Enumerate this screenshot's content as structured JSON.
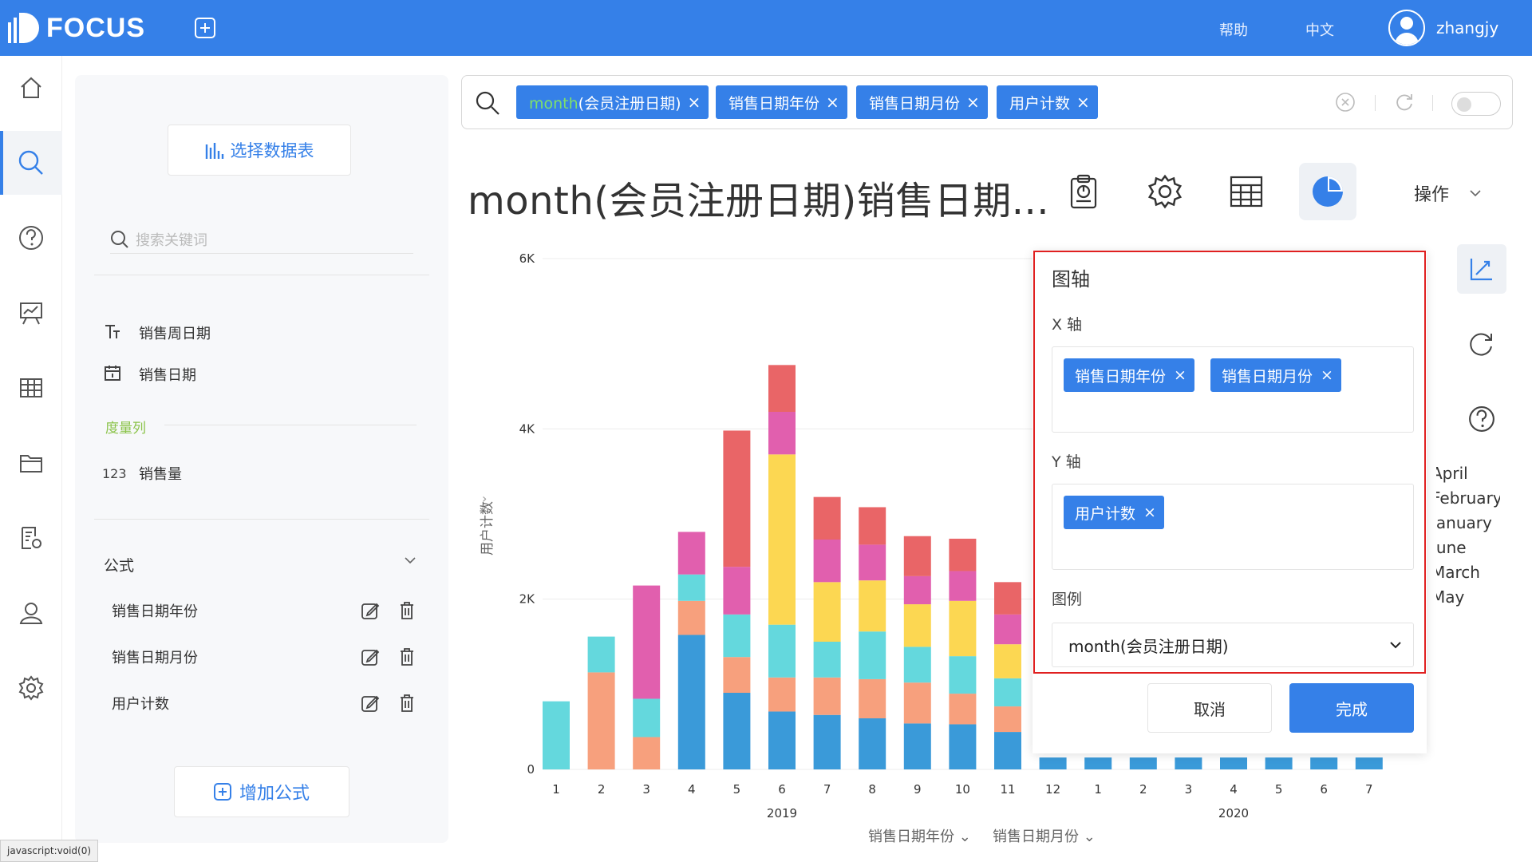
{
  "topbar": {
    "logo_text": "FOCUS",
    "help": "帮助",
    "language": "中文",
    "username": "zhangjy"
  },
  "colors": {
    "brand": "#3580e8",
    "highlight_border": "#e02020"
  },
  "sidebar": {
    "select_table_label": "选择数据表",
    "search_placeholder": "搜索关键词",
    "fields": [
      {
        "icon": "text-type-icon",
        "label": "销售周日期"
      },
      {
        "icon": "calendar-icon",
        "label": "销售日期"
      }
    ],
    "measure_title": "度量列",
    "measures": [
      {
        "icon": "123",
        "label": "销售量"
      }
    ],
    "formula_title": "公式",
    "formulas": [
      {
        "label": "销售日期年份"
      },
      {
        "label": "销售日期月份"
      },
      {
        "label": "用户计数"
      }
    ],
    "add_formula_label": "增加公式"
  },
  "search": {
    "chips": [
      {
        "highlight": "month",
        "rest": "(会员注册日期)"
      },
      {
        "label": "销售日期年份"
      },
      {
        "label": "销售日期月份"
      },
      {
        "label": "用户计数"
      }
    ]
  },
  "main": {
    "title": "month(会员注册日期)销售日期...",
    "operations_label": "操作"
  },
  "axes_panel": {
    "title": "图轴",
    "x_label": "X 轴",
    "x_chips": [
      "销售日期年份",
      "销售日期月份"
    ],
    "y_label": "Y 轴",
    "y_chips": [
      "用户计数"
    ],
    "legend_label": "图例",
    "legend_value": "month(会员注册日期)",
    "cancel": "取消",
    "done": "完成"
  },
  "legend_fragment": [
    "April",
    "February",
    "January",
    "June",
    "March",
    "May"
  ],
  "status_text": "javascript:void(0)",
  "chart_data": {
    "type": "bar",
    "stacked": true,
    "ylabel": "用户计数",
    "yticks": [
      "0",
      "2K",
      "4K",
      "6K"
    ],
    "ylim": [
      0,
      6000
    ],
    "x_groups": [
      {
        "year": "2019",
        "months": [
          "1",
          "2",
          "3",
          "4",
          "5",
          "6",
          "7",
          "8",
          "9",
          "10",
          "11"
        ]
      },
      {
        "year": "2019",
        "months": [
          "12"
        ]
      },
      {
        "year": "2020",
        "months": [
          "1",
          "2",
          "3",
          "4",
          "5",
          "6",
          "7"
        ]
      }
    ],
    "year_labels": [
      {
        "label": "2019",
        "after_index": 5
      },
      {
        "label": "2020",
        "after_index": 15
      }
    ],
    "x_axis_fields": [
      "销售日期年份",
      "销售日期月份"
    ],
    "series_colors": [
      "#3a9ad9",
      "#f7a07d",
      "#64d8dd",
      "#fcd752",
      "#e15fae",
      "#e96567"
    ],
    "bars": [
      [
        0,
        0,
        800,
        0,
        0,
        0
      ],
      [
        0,
        1140,
        420,
        0,
        0,
        0
      ],
      [
        0,
        380,
        450,
        0,
        1330,
        0
      ],
      [
        1580,
        400,
        310,
        0,
        500,
        0
      ],
      [
        900,
        420,
        500,
        0,
        560,
        1600
      ],
      [
        680,
        400,
        620,
        2000,
        500,
        550
      ],
      [
        640,
        440,
        420,
        700,
        500,
        500
      ],
      [
        600,
        460,
        560,
        600,
        420,
        440
      ],
      [
        540,
        480,
        420,
        500,
        330,
        470
      ],
      [
        530,
        360,
        440,
        650,
        350,
        380
      ],
      [
        440,
        300,
        330,
        400,
        350,
        380
      ],
      [
        140,
        0,
        0,
        0,
        0,
        0
      ],
      [
        140,
        0,
        0,
        0,
        0,
        0
      ],
      [
        140,
        0,
        0,
        0,
        0,
        0
      ],
      [
        140,
        0,
        0,
        0,
        0,
        0
      ],
      [
        140,
        0,
        0,
        0,
        0,
        0
      ],
      [
        140,
        0,
        0,
        0,
        0,
        0
      ],
      [
        140,
        0,
        0,
        0,
        0,
        0
      ],
      [
        140,
        0,
        0,
        0,
        0,
        0
      ]
    ],
    "x_labels": [
      "1",
      "2",
      "3",
      "4",
      "5",
      "6",
      "7",
      "8",
      "9",
      "10",
      "11",
      "12",
      "1",
      "2",
      "3",
      "4",
      "5",
      "6",
      "7"
    ]
  }
}
